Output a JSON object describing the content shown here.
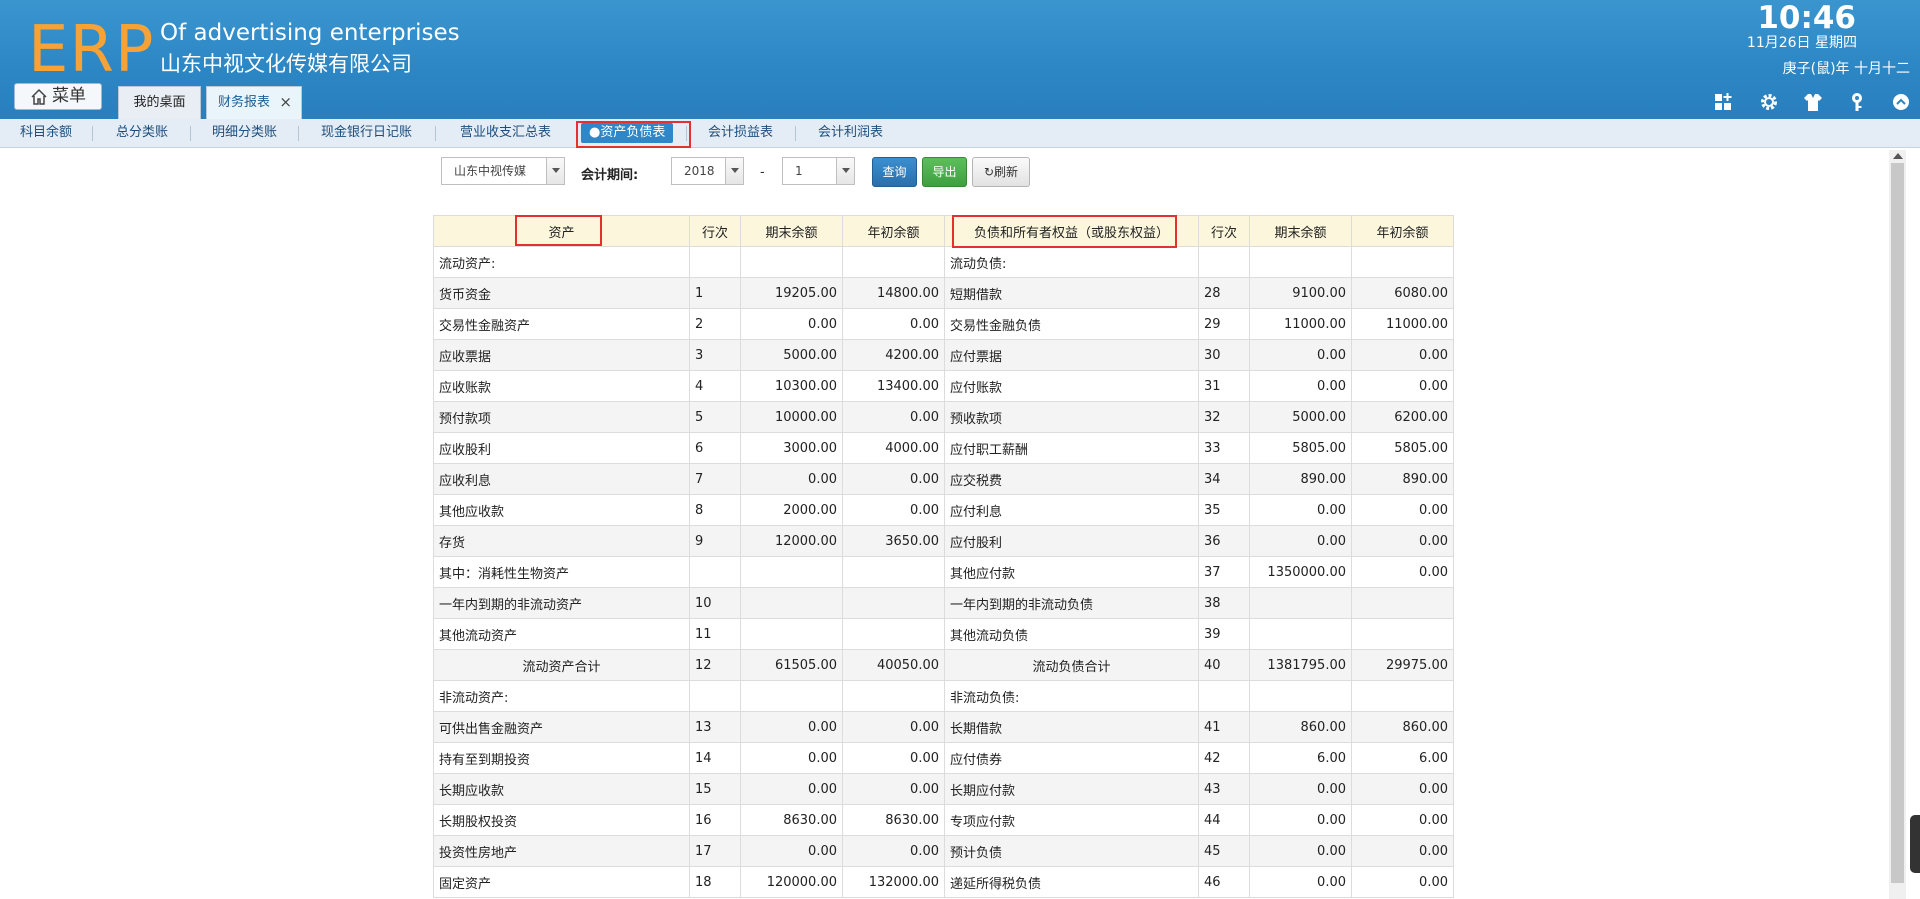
{
  "header": {
    "logo": "ERP",
    "title_en": "Of advertising enterprises",
    "title_cn": "山东中视文化传媒有限公司",
    "time": "10:46",
    "date": "11月26日 星期四",
    "lunar": "庚子(鼠)年 十月十二"
  },
  "menu": {
    "label": "菜单",
    "icon": "home-icon"
  },
  "tabs": [
    {
      "label": "我的桌面"
    },
    {
      "label": "财务报表",
      "close": "×"
    }
  ],
  "toolbar_icons": [
    "grid-add-icon",
    "gear-icon",
    "shirt-icon",
    "key-icon",
    "chevron-up-icon"
  ],
  "subnav": [
    {
      "label": "科目余额"
    },
    {
      "label": "总分类账"
    },
    {
      "label": "明细分类账"
    },
    {
      "label": "现金银行日记账"
    },
    {
      "label": "营业收支汇总表"
    },
    {
      "label": "●资产负债表",
      "active": true
    },
    {
      "label": "会计损益表"
    },
    {
      "label": "会计利润表"
    }
  ],
  "filters": {
    "company": "山东中视传媒",
    "period_label": "会计期间:",
    "year": "2018",
    "dash": "-",
    "month": "1",
    "query_label": "查询",
    "export_label": "导出",
    "refresh_label": "刷新"
  },
  "table": {
    "headers": [
      "资产",
      "行次",
      "期末余额",
      "年初余额",
      "负债和所有者权益（或股东权益）",
      "行次",
      "期末余额",
      "年初余额"
    ],
    "rows": [
      [
        "流动资产:",
        "",
        "",
        "",
        "流动负债:",
        "",
        "",
        ""
      ],
      [
        "货币资金",
        "1",
        "19205.00",
        "14800.00",
        "短期借款",
        "28",
        "9100.00",
        "6080.00"
      ],
      [
        "交易性金融资产",
        "2",
        "0.00",
        "0.00",
        "交易性金融负债",
        "29",
        "11000.00",
        "11000.00"
      ],
      [
        "应收票据",
        "3",
        "5000.00",
        "4200.00",
        "应付票据",
        "30",
        "0.00",
        "0.00"
      ],
      [
        "应收账款",
        "4",
        "10300.00",
        "13400.00",
        "应付账款",
        "31",
        "0.00",
        "0.00"
      ],
      [
        "预付款项",
        "5",
        "10000.00",
        "0.00",
        "预收款项",
        "32",
        "5000.00",
        "6200.00"
      ],
      [
        "应收股利",
        "6",
        "3000.00",
        "4000.00",
        "应付职工薪酬",
        "33",
        "5805.00",
        "5805.00"
      ],
      [
        "应收利息",
        "7",
        "0.00",
        "0.00",
        "应交税费",
        "34",
        "890.00",
        "890.00"
      ],
      [
        "其他应收款",
        "8",
        "2000.00",
        "0.00",
        "应付利息",
        "35",
        "0.00",
        "0.00"
      ],
      [
        "存货",
        "9",
        "12000.00",
        "3650.00",
        "应付股利",
        "36",
        "0.00",
        "0.00"
      ],
      [
        "其中：消耗性生物资产",
        "",
        "",
        "",
        "其他应付款",
        "37",
        "1350000.00",
        "0.00"
      ],
      [
        "一年内到期的非流动资产",
        "10",
        "",
        "",
        "一年内到期的非流动负债",
        "38",
        "",
        ""
      ],
      [
        "其他流动资产",
        "11",
        "",
        "",
        "其他流动负债",
        "39",
        "",
        ""
      ],
      [
        "流动资产合计",
        "12",
        "61505.00",
        "40050.00",
        "流动负债合计",
        "40",
        "1381795.00",
        "29975.00"
      ],
      [
        "非流动资产:",
        "",
        "",
        "",
        "非流动负债:",
        "",
        "",
        ""
      ],
      [
        "可供出售金融资产",
        "13",
        "0.00",
        "0.00",
        "长期借款",
        "41",
        "860.00",
        "860.00"
      ],
      [
        "持有至到期投资",
        "14",
        "0.00",
        "0.00",
        "应付债券",
        "42",
        "6.00",
        "6.00"
      ],
      [
        "长期应收款",
        "15",
        "0.00",
        "0.00",
        "长期应付款",
        "43",
        "0.00",
        "0.00"
      ],
      [
        "长期股权投资",
        "16",
        "8630.00",
        "8630.00",
        "专项应付款",
        "44",
        "0.00",
        "0.00"
      ],
      [
        "投资性房地产",
        "17",
        "0.00",
        "0.00",
        "预计负债",
        "45",
        "0.00",
        "0.00"
      ],
      [
        "固定资产",
        "18",
        "120000.00",
        "132000.00",
        "递延所得税负债",
        "46",
        "0.00",
        "0.00"
      ]
    ],
    "total_rows": [
      13
    ]
  }
}
